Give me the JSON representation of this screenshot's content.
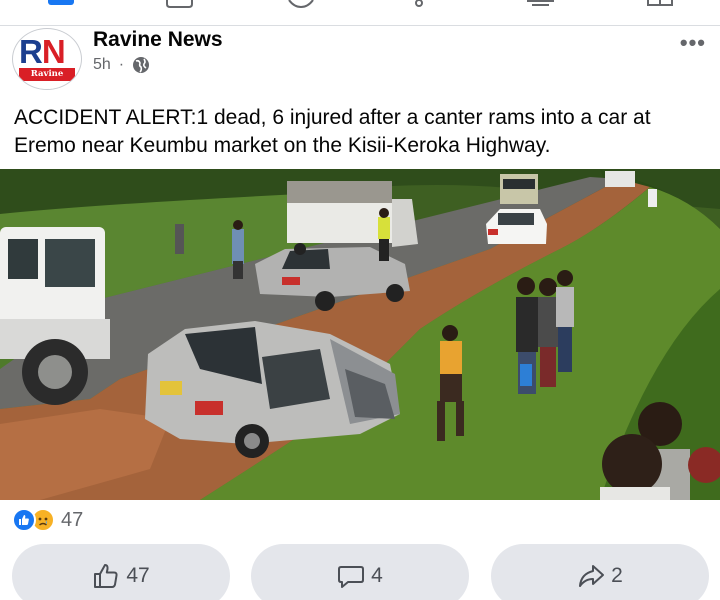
{
  "post": {
    "page_name": "Ravine News",
    "avatar_letters": "RN",
    "avatar_caption": "Ravine News",
    "time_ago": "5h",
    "dot": "·",
    "audience_icon": "globe-icon",
    "more_label": "•••",
    "text": "ACCIDENT ALERT:1 dead, 6 injured after a canter rams into a car at Eremo near Keumbu market on the Kisii-Keroka Highway."
  },
  "reactions": {
    "icons": [
      "like-icon",
      "sad-icon"
    ],
    "count": "47"
  },
  "actions": {
    "like_count": "47",
    "comment_count": "4",
    "share_count": "2"
  },
  "colors": {
    "accent": "#1877f2",
    "secondary_text": "#65676b",
    "button_bg": "#e4e6eb"
  }
}
